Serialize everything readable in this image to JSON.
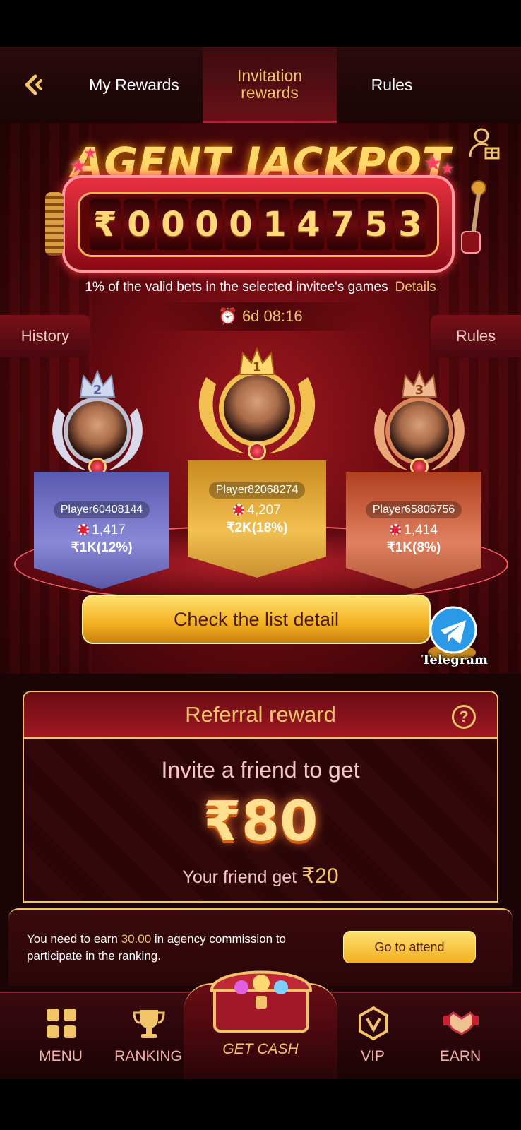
{
  "header": {
    "tabs": [
      {
        "label": "My Rewards"
      },
      {
        "label_line1": "Invitation",
        "label_line2": "rewards"
      },
      {
        "label": "Rules"
      }
    ]
  },
  "jackpot": {
    "title": "AGENT JACKPOT",
    "currency": "₹",
    "digits": [
      "0",
      "0",
      "0",
      "0",
      "1",
      "4",
      "7",
      "5",
      "3"
    ],
    "description": "1% of the valid bets in the selected invitee's games",
    "details_link": "Details",
    "timer": "6d 08:16",
    "history_button": "History",
    "rules_button": "Rules"
  },
  "podium": [
    {
      "rank": "2",
      "name": "Player60408144",
      "score": "1,417",
      "reward": "₹1K(12%)"
    },
    {
      "rank": "1",
      "name": "Player82068274",
      "score": "4,207",
      "reward": "₹2K(18%)"
    },
    {
      "rank": "3",
      "name": "Player65806756",
      "score": "1,414",
      "reward": "₹1K(8%)"
    }
  ],
  "check_list_button": "Check the list detail",
  "telegram_label": "Telegram",
  "referral": {
    "title": "Referral reward",
    "invite_text": "Invite a friend to get",
    "invite_amount": "₹80",
    "friend_get_text": "Your friend get",
    "friend_get_amount": "₹20"
  },
  "notice": {
    "text_before": "You need to earn ",
    "amount": "30.00",
    "text_after": " in agency commission to participate in the ranking.",
    "button": "Go to attend"
  },
  "bottom_nav": [
    {
      "label": "MENU",
      "icon": "menu-grid-icon"
    },
    {
      "label": "RANKING",
      "icon": "trophy-icon"
    },
    {
      "label": "GET CASH",
      "icon": "treasure-chest-icon"
    },
    {
      "label": "VIP",
      "icon": "vip-shield-icon"
    },
    {
      "label": "EARN",
      "icon": "handshake-icon"
    }
  ],
  "colors": {
    "accent_gold": "#f2c46a",
    "brand_red": "#a01822",
    "background_dark": "#1a0406"
  }
}
